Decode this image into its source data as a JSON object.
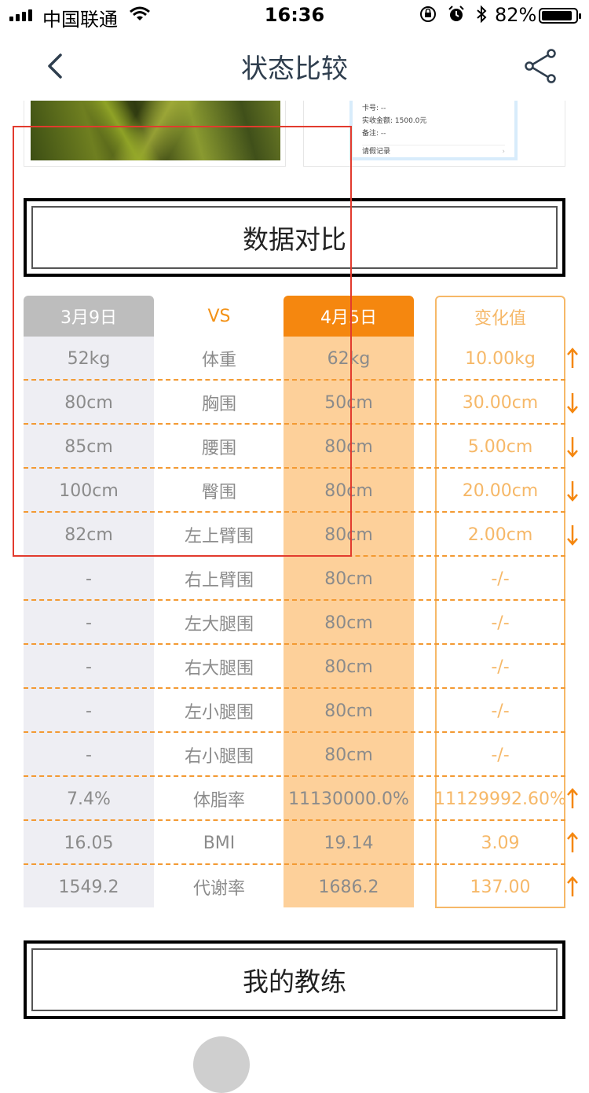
{
  "status_bar": {
    "carrier": "中国联通",
    "time": "16:36",
    "battery_percent": "82%",
    "icons": [
      "signal-icon",
      "wifi-icon",
      "orientation-lock-icon",
      "alarm-icon",
      "bluetooth-icon",
      "battery-icon"
    ]
  },
  "navbar": {
    "title": "状态比较",
    "back_icon": "chevron-left-icon",
    "share_icon": "share-icon"
  },
  "photo_right_doc": {
    "line1": "卡号: --",
    "line2": "实收金额: 1500.0元",
    "line3": "备注: --",
    "record": "请假记录"
  },
  "data_section": {
    "title": "数据对比"
  },
  "comparison": {
    "header": {
      "date1": "3月9日",
      "vs": "VS",
      "date2": "4月5日",
      "change": "变化值"
    },
    "rows": [
      {
        "before": "52kg",
        "label": "体重",
        "after": "62kg",
        "change": "10.00kg",
        "direction": "up"
      },
      {
        "before": "80cm",
        "label": "胸围",
        "after": "50cm",
        "change": "30.00cm",
        "direction": "down"
      },
      {
        "before": "85cm",
        "label": "腰围",
        "after": "80cm",
        "change": "5.00cm",
        "direction": "down"
      },
      {
        "before": "100cm",
        "label": "臀围",
        "after": "80cm",
        "change": "20.00cm",
        "direction": "down"
      },
      {
        "before": "82cm",
        "label": "左上臂围",
        "after": "80cm",
        "change": "2.00cm",
        "direction": "down"
      },
      {
        "before": "-",
        "label": "右上臂围",
        "after": "80cm",
        "change": "-/-",
        "direction": ""
      },
      {
        "before": "-",
        "label": "左大腿围",
        "after": "80cm",
        "change": "-/-",
        "direction": ""
      },
      {
        "before": "-",
        "label": "右大腿围",
        "after": "80cm",
        "change": "-/-",
        "direction": ""
      },
      {
        "before": "-",
        "label": "左小腿围",
        "after": "80cm",
        "change": "-/-",
        "direction": ""
      },
      {
        "before": "-",
        "label": "右小腿围",
        "after": "80cm",
        "change": "-/-",
        "direction": ""
      },
      {
        "before": "7.4%",
        "label": "体脂率",
        "after": "11130000.0%",
        "change": "11129992.60%",
        "direction": "up"
      },
      {
        "before": "16.05",
        "label": "BMI",
        "after": "19.14",
        "change": "3.09",
        "direction": "up"
      },
      {
        "before": "1549.2",
        "label": "代谢率",
        "after": "1686.2",
        "change": "137.00",
        "direction": "up"
      }
    ]
  },
  "coach_section": {
    "title": "我的教练"
  },
  "colors": {
    "accent": "#f5870f",
    "change": "#f6b868",
    "before_col": "#eeeef3",
    "after_col": "#fdd09a",
    "annotation": "#e23b2e"
  }
}
